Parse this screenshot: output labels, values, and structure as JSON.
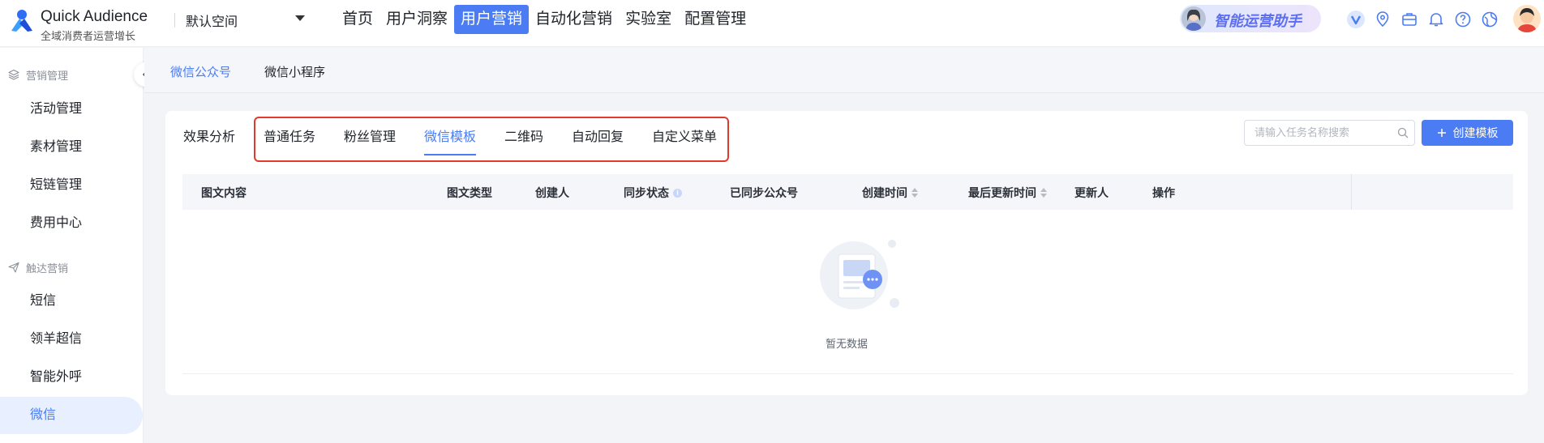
{
  "brand": {
    "name": "Quick Audience",
    "tagline": "全域消费者运营增长"
  },
  "workspace": {
    "label": "默认空间"
  },
  "nav": [
    {
      "label": "首页"
    },
    {
      "label": "用户洞察"
    },
    {
      "label": "用户营销",
      "active": true
    },
    {
      "label": "自动化营销"
    },
    {
      "label": "实验室"
    },
    {
      "label": "配置管理"
    }
  ],
  "assistant": {
    "label": "智能运营助手"
  },
  "top_icons": [
    "v-badge-icon",
    "location-icon",
    "briefcase-icon",
    "bell-icon",
    "help-icon",
    "globe-icon"
  ],
  "sidebar": {
    "groups": [
      {
        "title": "营销管理",
        "icon": "layers-icon",
        "items": [
          "活动管理",
          "素材管理",
          "短链管理",
          "费用中心"
        ]
      },
      {
        "title": "触达营销",
        "icon": "send-icon",
        "items": [
          "短信",
          "领羊超信",
          "智能外呼",
          "微信"
        ]
      }
    ],
    "active_item": "微信"
  },
  "subtabs": [
    {
      "label": "微信公众号",
      "active": true
    },
    {
      "label": "微信小程序"
    }
  ],
  "content_tabs": [
    {
      "label": "效果分析"
    },
    {
      "label": "普通任务"
    },
    {
      "label": "粉丝管理"
    },
    {
      "label": "微信模板",
      "active": true
    },
    {
      "label": "二维码"
    },
    {
      "label": "自动回复"
    },
    {
      "label": "自定义菜单"
    }
  ],
  "search": {
    "placeholder": "请输入任务名称搜索",
    "value": ""
  },
  "create_button": {
    "label": "创建模板"
  },
  "table": {
    "columns": [
      "图文内容",
      "图文类型",
      "创建人",
      "同步状态",
      "已同步公众号",
      "创建时间",
      "最后更新时间",
      "更新人",
      "操作"
    ],
    "rows": []
  },
  "empty": {
    "text": "暂无数据"
  },
  "colors": {
    "accent": "#4c7cf3",
    "highlight": "#e03a2c",
    "nav_active_bg": "#4c7cf3"
  }
}
